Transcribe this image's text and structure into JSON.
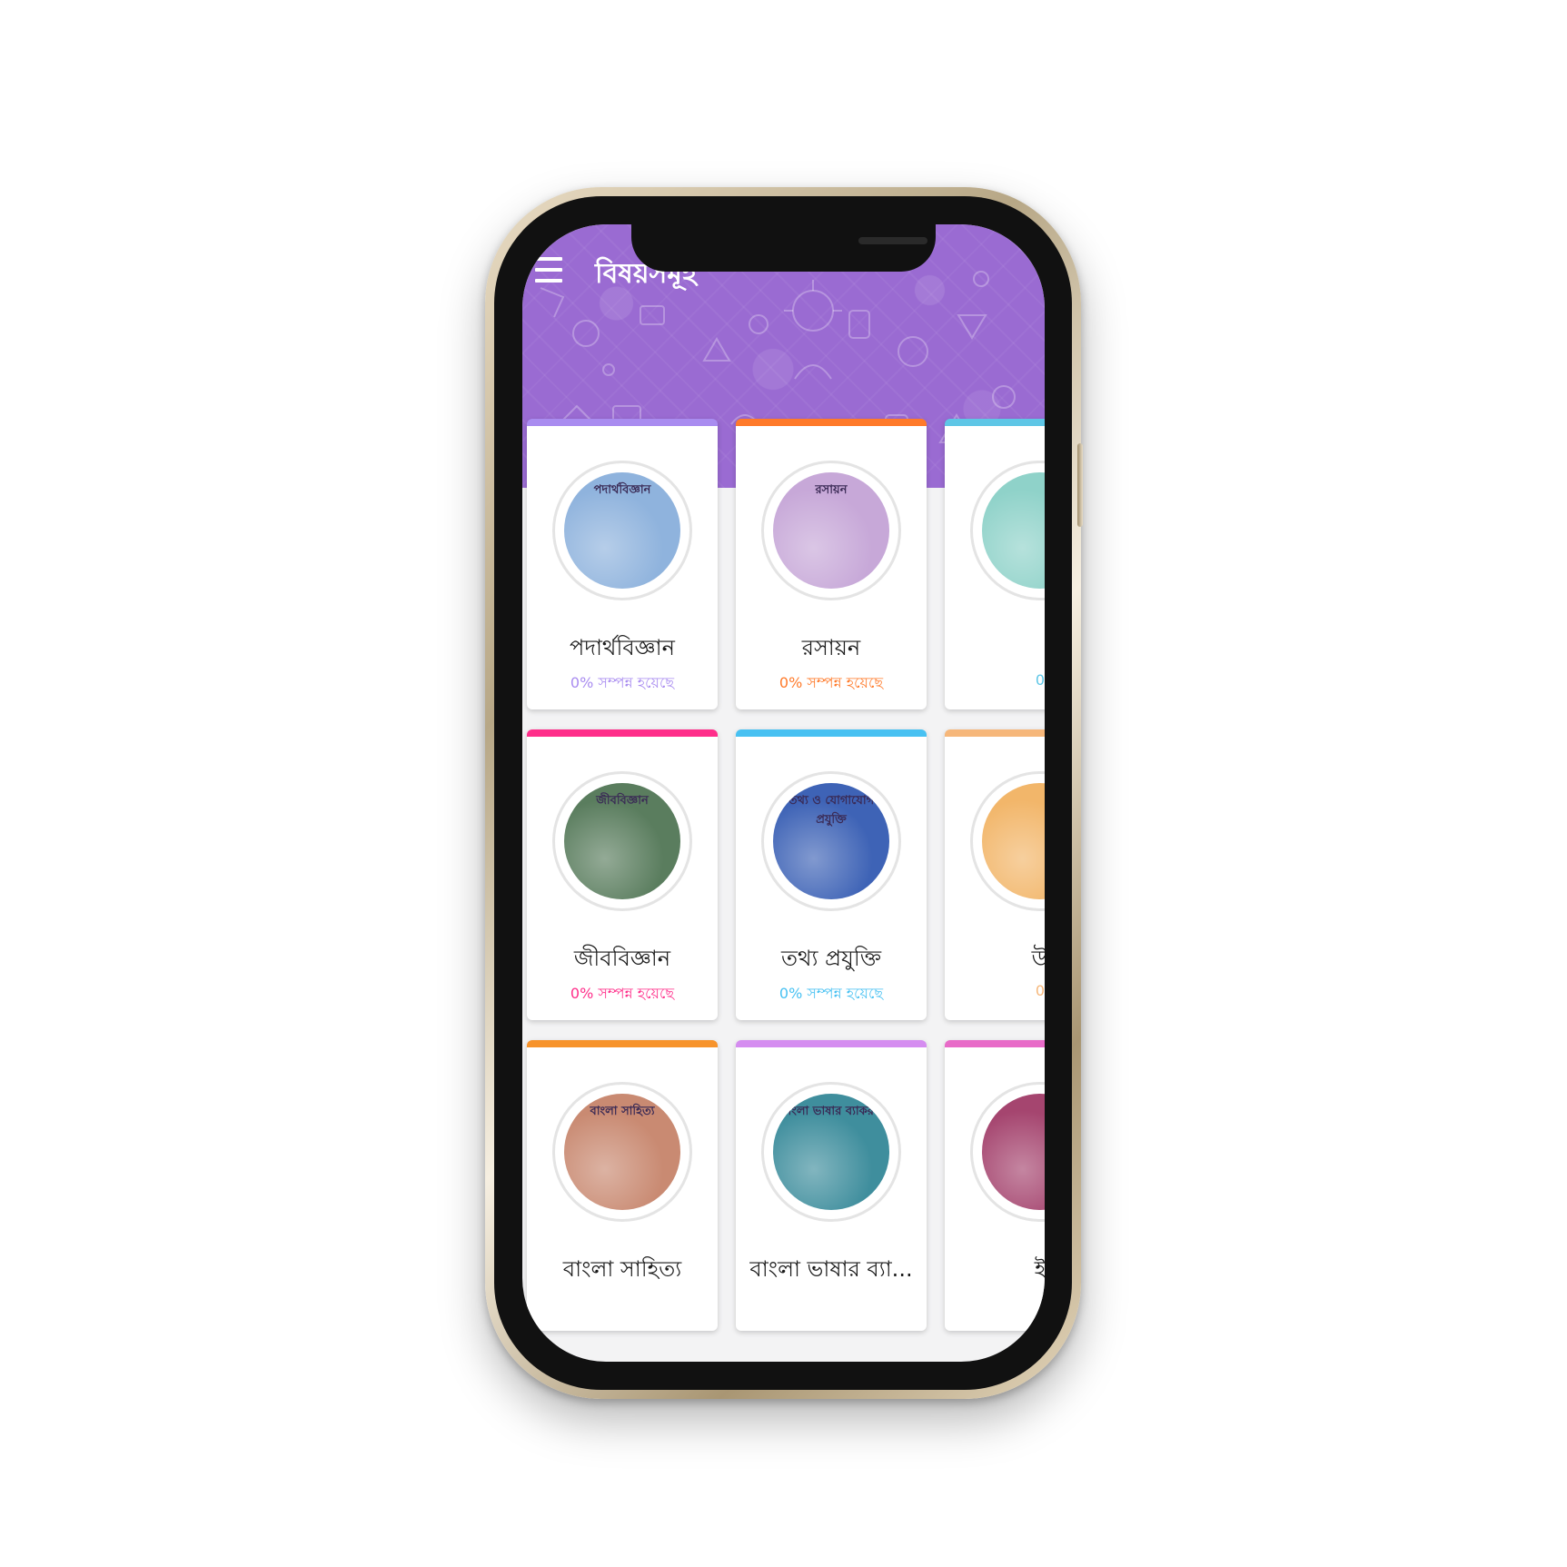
{
  "app": {
    "page_title": "বিষয়সমূহ",
    "menu_icon": "hamburger-menu-icon"
  },
  "subjects": [
    {
      "name": "পদার্থবিজ্ঞান",
      "progress": "0% সম্পন্ন হয়েছে",
      "cover_title": "পদার্থবিজ্ঞান",
      "accent": "#a98cf0",
      "cover_bg": "#8fb3dd"
    },
    {
      "name": "রসায়ন",
      "progress": "0% সম্পন্ন হয়েছে",
      "cover_title": "রসায়ন",
      "accent": "#ff7a2a",
      "cover_bg": "#c7a8d8"
    },
    {
      "name": "",
      "progress": "0",
      "cover_title": "",
      "accent": "#5ec6e6",
      "cover_bg": "#8fd2c9"
    },
    {
      "name": "জীববিজ্ঞান",
      "progress": "0% সম্পন্ন হয়েছে",
      "cover_title": "জীববিজ্ঞান",
      "accent": "#ff2e8a",
      "cover_bg": "#5a7d5e"
    },
    {
      "name": "তথ্য প্রযুক্তি",
      "progress": "0% সম্পন্ন হয়েছে",
      "cover_title": "তথ্য ও যোগাযোগ প্রযুক্তি",
      "accent": "#48c1f2",
      "cover_bg": "#3e63b6"
    },
    {
      "name": "উ",
      "progress": "0",
      "cover_title": "",
      "accent": "#f6b77a",
      "cover_bg": "#f2b66a"
    },
    {
      "name": "বাংলা সাহিত্য",
      "progress": "",
      "cover_title": "বাংলা সাহিত্য",
      "accent": "#f7932b",
      "cover_bg": "#c98a72"
    },
    {
      "name": "বাংলা ভাষার ব্যা...",
      "progress": "",
      "cover_title": "বাংলা ভাষার ব্যাকরণ",
      "accent": "#d58df0",
      "cover_bg": "#3f8e9d"
    },
    {
      "name": "ই",
      "progress": "",
      "cover_title": "",
      "accent": "#e86bc8",
      "cover_bg": "#a5456f"
    }
  ]
}
